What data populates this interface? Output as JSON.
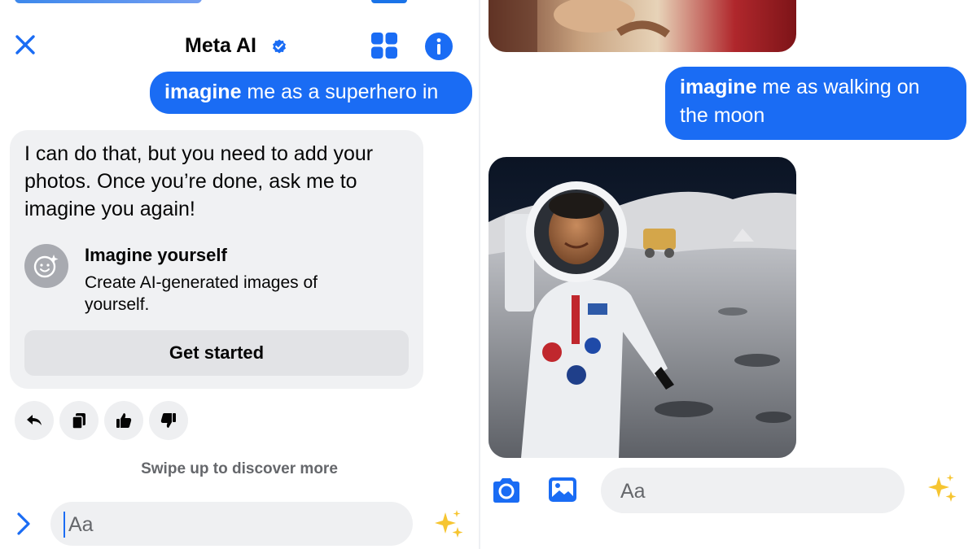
{
  "left": {
    "header": {
      "title": "Meta AI"
    },
    "outgoing_message": {
      "bold": "imagine",
      "rest": " me as a superhero in"
    },
    "ai_reply": {
      "text": "I can do that, but you need to add your photos. Once you’re done, ask me to imagine you again!",
      "card_title": "Imagine yourself",
      "card_description": "Create AI-generated images of yourself.",
      "button_label": "Get started"
    },
    "reactions": [
      "reply-icon",
      "copy-icon",
      "thumbs-up-icon",
      "thumbs-down-icon"
    ],
    "hint": "Swipe up to discover more",
    "composer": {
      "placeholder": "Aa"
    }
  },
  "right": {
    "outgoing_message": {
      "bold": "imagine",
      "rest": " me as walking on the moon"
    },
    "composer": {
      "placeholder": "Aa"
    }
  },
  "colors": {
    "accent": "#1a6cf4",
    "bubble_in": "#f0f1f3",
    "muted_text": "#65676b"
  },
  "icons": [
    "close-icon",
    "verified-badge-icon",
    "grid-icon",
    "info-icon",
    "chevron-right-icon",
    "sparkles-icon",
    "camera-icon",
    "gallery-icon"
  ]
}
